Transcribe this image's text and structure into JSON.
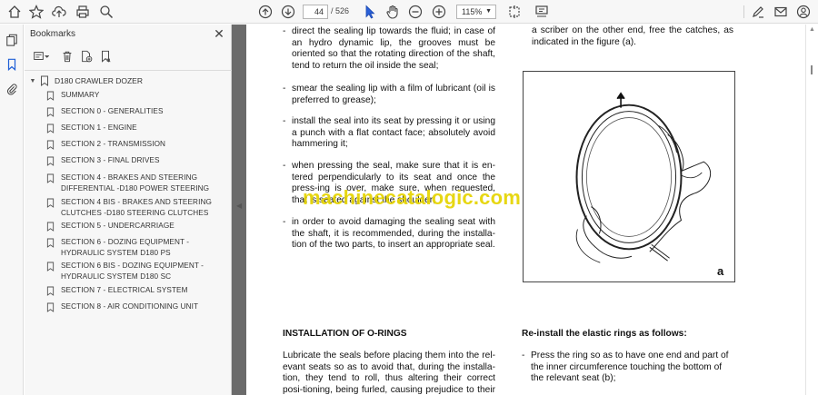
{
  "toolbar": {
    "page_current": "44",
    "page_total": "/ 526",
    "zoom": "115%"
  },
  "bookmarks": {
    "title": "Bookmarks",
    "root": "D180 CRAWLER DOZER",
    "items": [
      {
        "label": "SUMMARY"
      },
      {
        "label": "SECTION 0 - GENERALITIES"
      },
      {
        "label": "SECTION 1 - ENGINE"
      },
      {
        "label": "SECTION 2 - TRANSMISSION"
      },
      {
        "label": "SECTION 3 - FINAL DRIVES"
      },
      {
        "label": "SECTION 4 - BRAKES AND STEERING DIFFERENTIAL -D180 POWER STEERING"
      },
      {
        "label": "SECTION 4 BIS - BRAKES AND STEERING CLUTCHES -D180 STEERING CLUTCHES"
      },
      {
        "label": "SECTION 5 - UNDERCARRIAGE"
      },
      {
        "label": "SECTION 6 - DOZING EQUIPMENT - HYDRAULIC SYSTEM D180 PS"
      },
      {
        "label": "SECTION 6 BIS - DOZING EQUIPMENT - HYDRAULIC SYSTEM D180 SC"
      },
      {
        "label": "SECTION 7 - ELECTRICAL SYSTEM"
      },
      {
        "label": "SECTION 8 - AIR CONDITIONING UNIT"
      }
    ]
  },
  "document": {
    "left_bullets": [
      "direct the sealing lip towards the fluid; in case of an hydro dynamic lip, the grooves must be oriented so that the rotating direction of the shaft, tend to return the oil inside the seal;",
      "smear the sealing lip with a film of lubricant (oil is preferred to grease);",
      "install the seal into its seat by pressing it or using a punch with a flat contact face; absolutely avoid hammering it;",
      "when pressing the seal, make sure that it is en-tered perpendicularly to its seat and once the press-ing is over, make sure, when requested, that is seated against the shoulder;",
      "in order to avoid damaging the sealing seat with the shaft, it is recommended, during the installa-tion of the two parts, to insert an appropriate seal."
    ],
    "right_top": "a scriber on the other end, free the catches, as indicated in the figure (a).",
    "figure_label": "a",
    "watermark": "machinecatalogic.com",
    "heading_left": "INSTALLATION OF O-RINGS",
    "para_left": "Lubricate the seals before placing them into the rel-evant seats so as to avoid that, during the installa-tion, they tend to roll, thus altering their correct posi-tioning, being furled, causing prejudice to their seal-",
    "heading_right": "Re-install the elastic rings as follows:",
    "right_bullet": "Press the ring so as to have one end and part of the inner circumference touching the bottom of the relevant seat (b);"
  }
}
